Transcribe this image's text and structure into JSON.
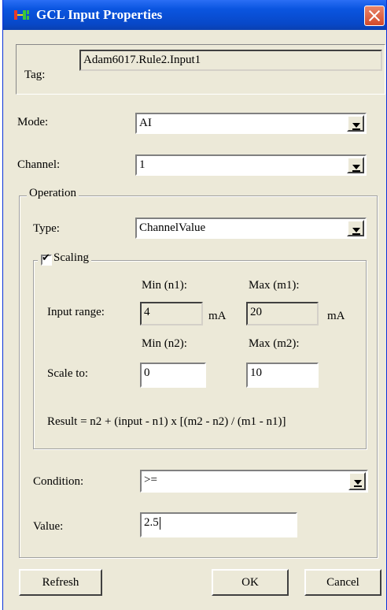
{
  "window": {
    "title": "GCL Input Properties"
  },
  "tag": {
    "label": "Tag:",
    "value": "Adam6017.Rule2.Input1"
  },
  "mode": {
    "label": "Mode:",
    "value": "AI"
  },
  "channel": {
    "label": "Channel:",
    "value": "1"
  },
  "operation": {
    "legend": "Operation",
    "type_label": "Type:",
    "type_value": "ChannelValue",
    "scaling": {
      "label": "Scaling",
      "checked": true,
      "min_n1_label": "Min (n1):",
      "max_m1_label": "Max (m1):",
      "input_range_label": "Input range:",
      "input_min": "4",
      "input_max": "20",
      "unit1": "mA",
      "unit2": "mA",
      "min_n2_label": "Min (n2):",
      "max_m2_label": "Max (m2):",
      "scale_to_label": "Scale to:",
      "scale_min": "0",
      "scale_max": "10",
      "formula": "Result = n2 + (input - n1) x [(m2 - n2) / (m1 - n1)]"
    },
    "condition_label": "Condition:",
    "condition_value": ">=",
    "value_label": "Value:",
    "value": "2.5"
  },
  "buttons": {
    "refresh": "Refresh",
    "ok": "OK",
    "cancel": "Cancel"
  }
}
